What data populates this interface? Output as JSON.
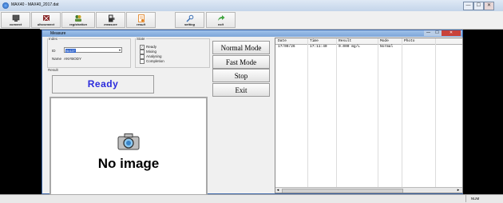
{
  "window": {
    "title": "MAX40 - MAX40_2017.dat",
    "min": "—",
    "max": "☐",
    "close": "✕"
  },
  "toolbar": [
    {
      "label": "connect",
      "icon": "monitor-icon"
    },
    {
      "label": "disconnect",
      "icon": "disconnect-icon"
    },
    {
      "label": "registration",
      "icon": "users-icon"
    },
    {
      "label": "measure",
      "icon": "device-icon"
    },
    {
      "label": "result",
      "icon": "result-icon"
    },
    {
      "label": "setting",
      "icon": "setting-icon"
    },
    {
      "label": "exit",
      "icon": "exit-arrow-icon"
    }
  ],
  "dialog": {
    "title": "Measure",
    "index": {
      "legend": "Index",
      "id_label": "ID",
      "id_value": "6c127",
      "name_label": "Name",
      "name_value": "ANYBODY"
    },
    "state": {
      "legend": "State",
      "items": [
        "Ready",
        "Mixing",
        "Analysing",
        "Completion"
      ],
      "checked": [
        true,
        false,
        false,
        false
      ]
    },
    "result": {
      "legend": "Result",
      "value": "Ready"
    },
    "buttons": {
      "normal": "Normal Mode",
      "fast": "Fast Mode",
      "stop": "Stop",
      "exit": "Exit"
    },
    "image": {
      "placeholder": "No image"
    },
    "grid": {
      "columns": [
        "Date",
        "Time",
        "Result",
        "Mode",
        "Photo"
      ],
      "rows": [
        [
          "17/09/26",
          "17:11:40",
          "0.000 mg/L",
          "Normal",
          ""
        ]
      ]
    }
  },
  "statusbar": {
    "num": "NUM"
  }
}
